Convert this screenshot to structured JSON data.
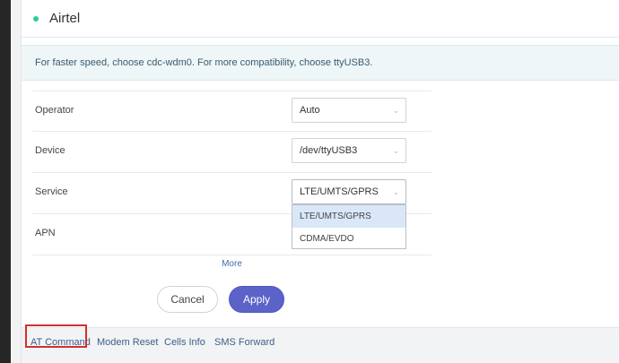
{
  "header": {
    "title": "Airtel",
    "status_color": "#2ecc8f"
  },
  "notice": "For faster speed, choose cdc-wdm0. For more compatibility, choose ttyUSB3.",
  "form": {
    "rows": [
      {
        "label": "Operator",
        "value": "Auto"
      },
      {
        "label": "Device",
        "value": "/dev/ttyUSB3"
      },
      {
        "label": "Service",
        "value": "LTE/UMTS/GPRS"
      },
      {
        "label": "APN",
        "value": ""
      }
    ],
    "service_options": [
      "LTE/UMTS/GPRS",
      "CDMA/EVDO"
    ],
    "more_label": "More",
    "cancel_label": "Cancel",
    "apply_label": "Apply"
  },
  "tabs": [
    "AT Command",
    "Modem Reset",
    "Cells Info",
    "SMS Forward"
  ],
  "accent": "#5b62c8"
}
